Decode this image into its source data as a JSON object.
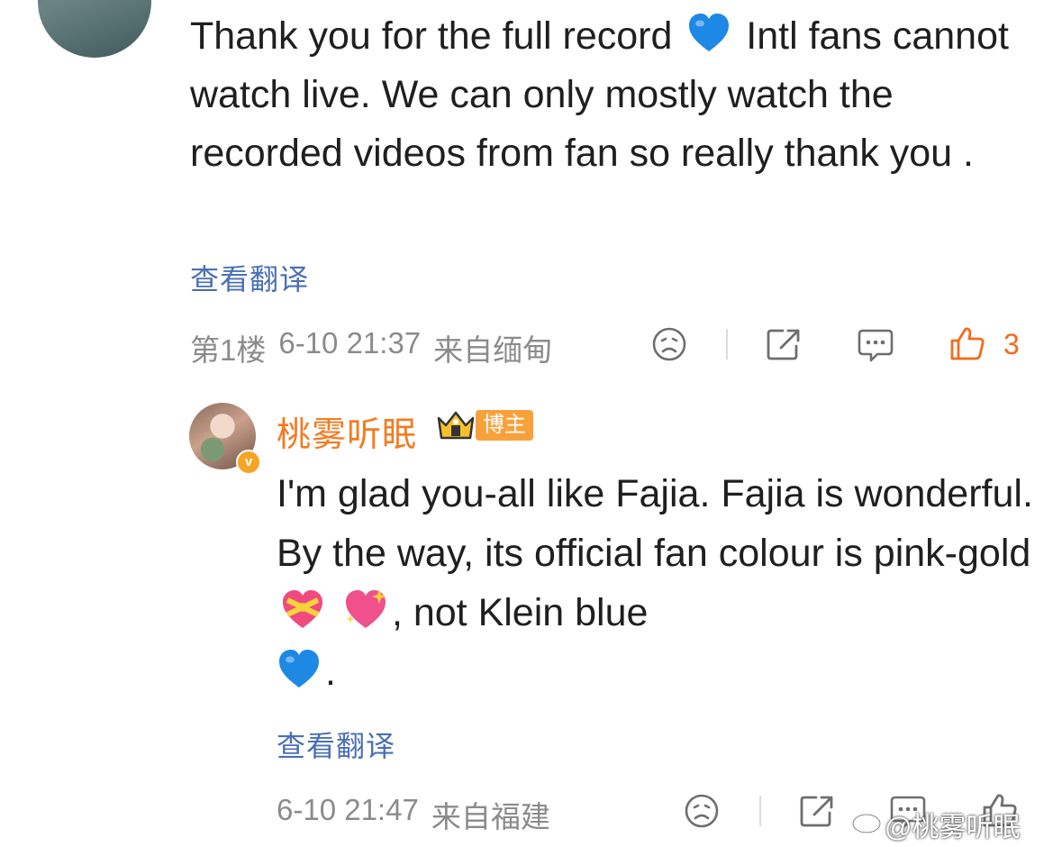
{
  "comment": {
    "text_parts": [
      "Thank you for the full record",
      "Intl fans cannot watch live. We can only mostly watch the recorded videos from fan so really thank you ."
    ],
    "emoji_after_first": "blue-heart",
    "translate_label": "查看翻译",
    "floor": "第1楼",
    "time": "6-10 21:37",
    "source": "来自缅甸",
    "like_count": "3"
  },
  "reply": {
    "username": "桃雾听眠",
    "badge_label": "博主",
    "verified_mark": "v",
    "text_parts": [
      "I'm glad you-all like Fajia. Fajia is wonderful. By the way, its official fan colour is pink-gold",
      ", not Klein blue",
      "."
    ],
    "emojis": [
      "heart-with-ribbon",
      "sparkling-heart",
      "blue-heart"
    ],
    "translate_label": "查看翻译",
    "time": "6-10 21:47",
    "source": "来自福建"
  },
  "watermark": "@桃雾听眠",
  "colors": {
    "link": "#4a6fb4",
    "accent": "#f47b20",
    "like": "#f26b1d",
    "meta": "#8b8b8b",
    "blue_heart": "#1e88e5"
  },
  "icons": [
    "dislike-face-icon",
    "share-icon",
    "comment-icon",
    "thumbs-up-icon",
    "crown-icon",
    "weibo-logo-icon"
  ]
}
